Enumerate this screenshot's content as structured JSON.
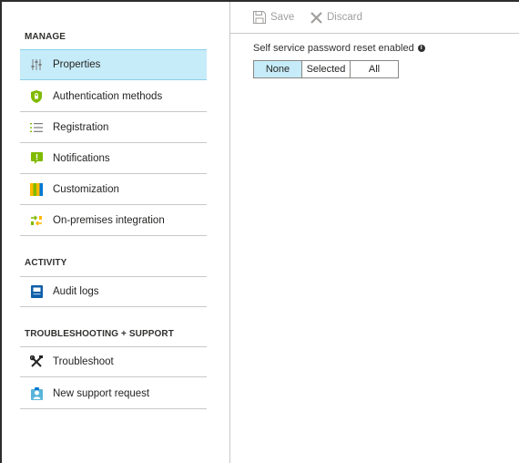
{
  "toolbar": {
    "save_label": "Save",
    "discard_label": "Discard"
  },
  "sections": {
    "manage": "MANAGE",
    "activity": "ACTIVITY",
    "troubleshooting": "TROUBLESHOOTING + SUPPORT"
  },
  "nav": {
    "properties": "Properties",
    "authentication_methods": "Authentication methods",
    "registration": "Registration",
    "notifications": "Notifications",
    "customization": "Customization",
    "on_premises_integration": "On-premises integration",
    "audit_logs": "Audit logs",
    "troubleshoot": "Troubleshoot",
    "new_support_request": "New support request"
  },
  "main": {
    "field_label": "Self service password reset enabled",
    "options": {
      "none": "None",
      "selected": "Selected",
      "all": "All"
    },
    "selected_option": "None"
  },
  "colors": {
    "active_bg": "#c6ecf9",
    "border": "#c8c8c8",
    "disabled_text": "#a19f9d"
  }
}
